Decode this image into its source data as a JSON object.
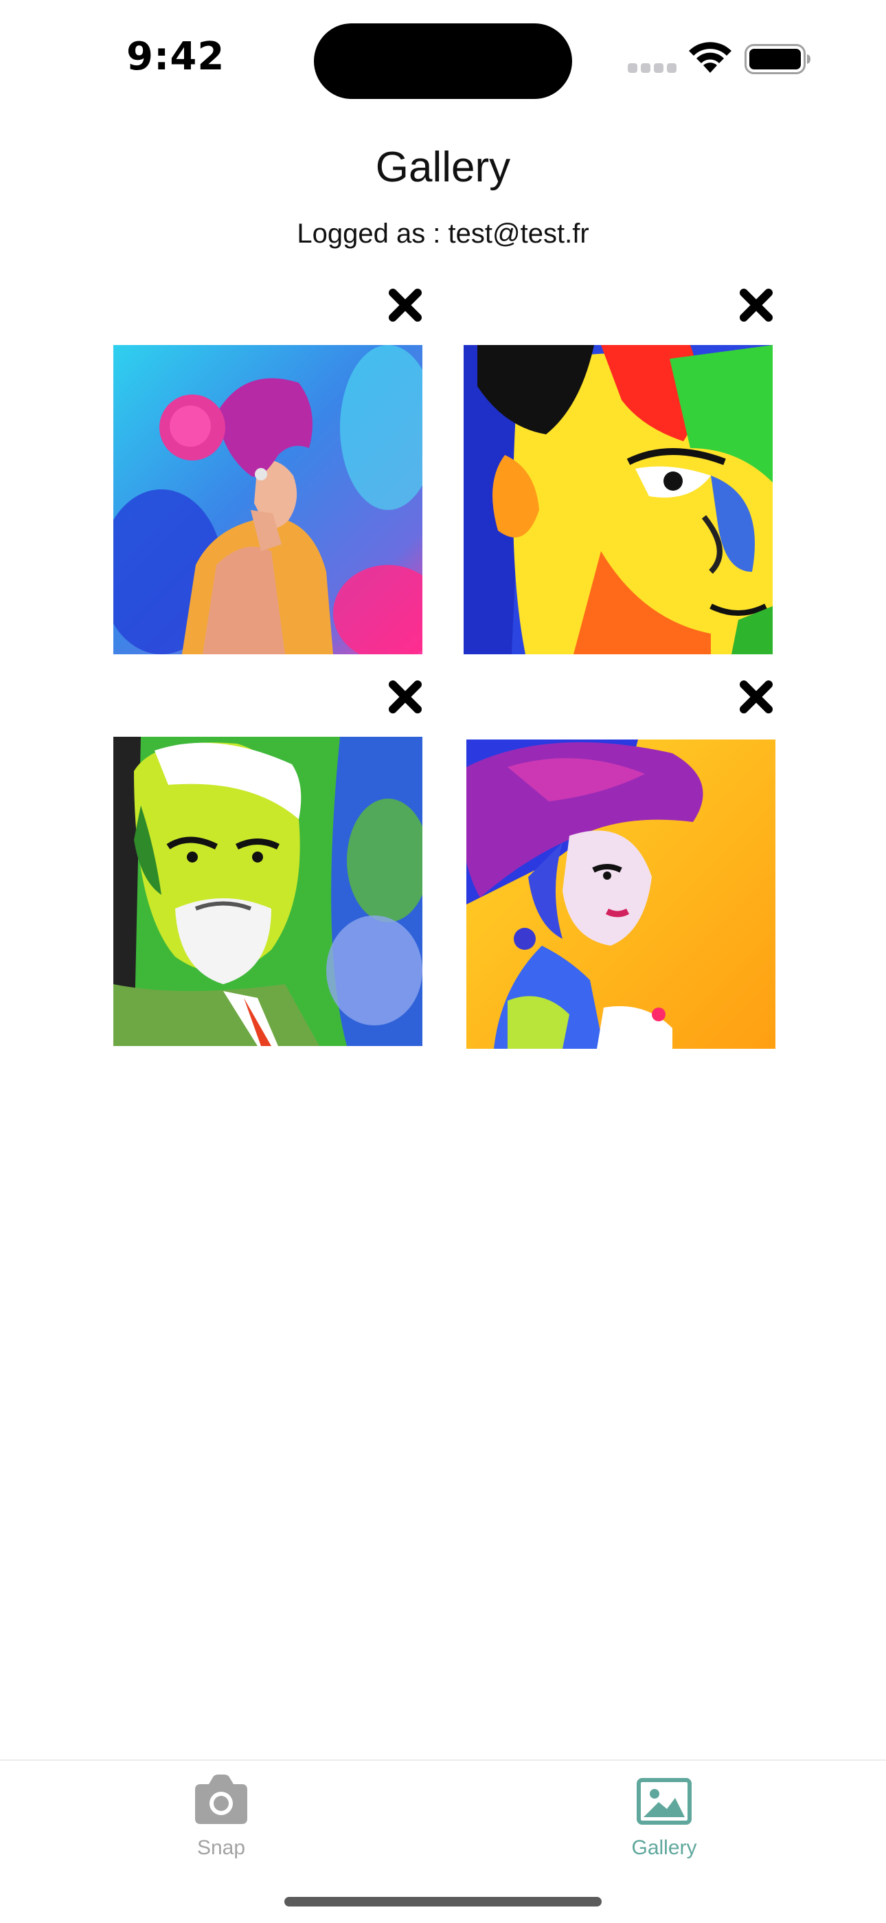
{
  "status_bar": {
    "time": "9:42",
    "icons": [
      "cellular-signal-icon",
      "wifi-icon",
      "battery-icon"
    ]
  },
  "header": {
    "title": "Gallery",
    "logged_as": "Logged as : test@test.fr"
  },
  "gallery": {
    "items": [
      {
        "image": "woman-pink-hair-watercolor-portrait",
        "delete_icon": "close-icon"
      },
      {
        "image": "man-colorful-face-watercolor-portrait",
        "delete_icon": "close-icon"
      },
      {
        "image": "old-man-white-beard-watercolor-portrait",
        "delete_icon": "close-icon"
      },
      {
        "image": "woman-hat-watercolor-portrait",
        "delete_icon": "close-icon"
      }
    ]
  },
  "tab_bar": {
    "tabs": [
      {
        "label": "Snap",
        "icon": "camera-icon",
        "active": false
      },
      {
        "label": "Gallery",
        "icon": "image-icon",
        "active": true
      }
    ],
    "active_color": "#5fa79c",
    "inactive_color": "#a3a3a3"
  }
}
